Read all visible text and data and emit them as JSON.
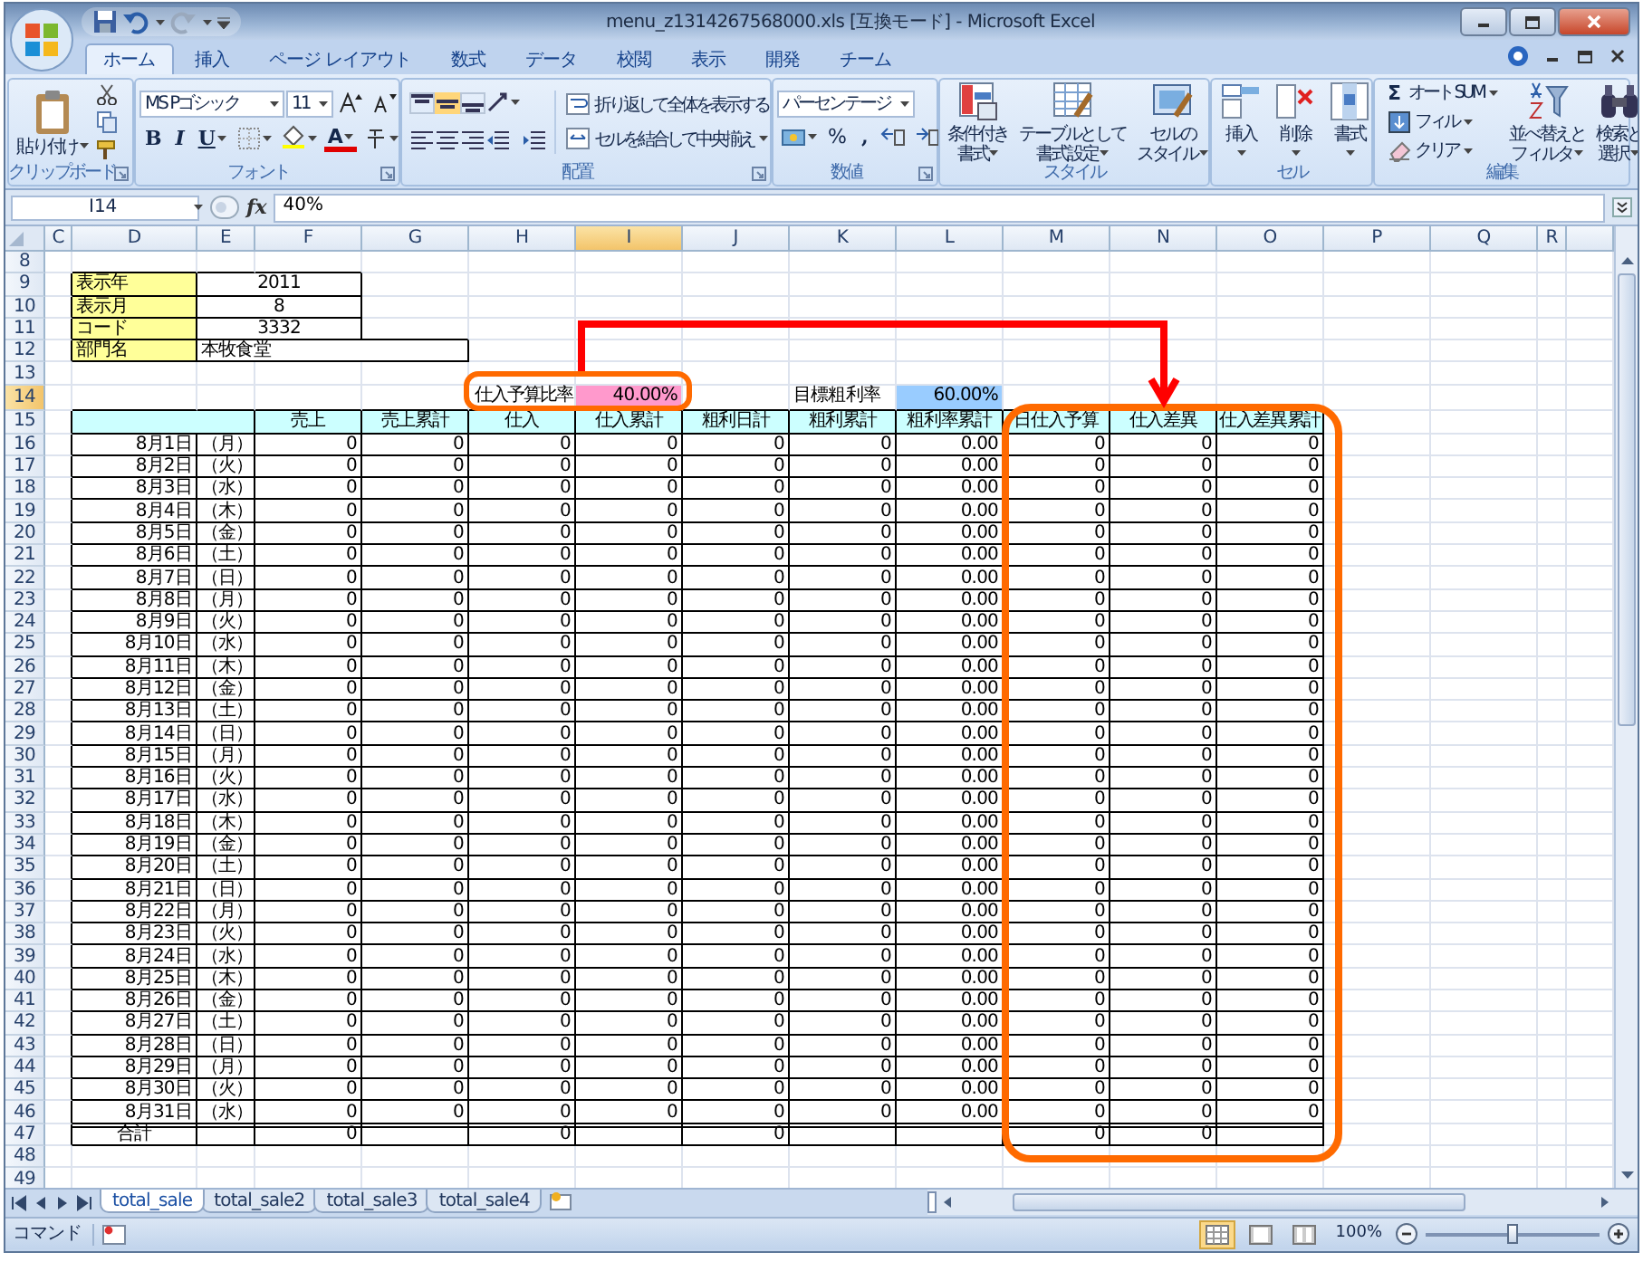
{
  "window": {
    "title": "menu_z1314267568000.xls [互換モード] - Microsoft Excel"
  },
  "ribbon_tabs": [
    {
      "label": "ホーム",
      "selected": true
    },
    {
      "label": "挿入",
      "selected": false
    },
    {
      "label": "ページ レイアウト",
      "selected": false
    },
    {
      "label": "数式",
      "selected": false
    },
    {
      "label": "データ",
      "selected": false
    },
    {
      "label": "校閲",
      "selected": false
    },
    {
      "label": "表示",
      "selected": false
    },
    {
      "label": "開発",
      "selected": false
    },
    {
      "label": "チーム",
      "selected": false
    }
  ],
  "ribbon": {
    "clipboard": {
      "label": "クリップボード",
      "paste": "貼り付け"
    },
    "font": {
      "label": "フォント",
      "font_name": "MS Pゴシック",
      "font_size": "11",
      "bold": "B",
      "italic": "I",
      "underline": "U",
      "font_color": "A"
    },
    "alignment": {
      "label": "配置",
      "wrap_text": "折り返して全体を表示する",
      "merge_center": "セルを結合して中央揃え"
    },
    "number": {
      "label": "数値",
      "format": "パーセンテージ",
      "percent": "%",
      "comma": ","
    },
    "styles": {
      "label": "スタイル",
      "buttons": [
        {
          "lines": [
            "条件付き",
            "書式"
          ],
          "kind": "conditional"
        },
        {
          "lines": [
            "テーブルとして",
            "書式設定"
          ],
          "kind": "table"
        },
        {
          "lines": [
            "セルの",
            "スタイル"
          ],
          "kind": "cellstyle"
        }
      ]
    },
    "cells": {
      "label": "セル",
      "buttons": [
        {
          "label": "挿入",
          "kind": "insert"
        },
        {
          "label": "削除",
          "kind": "delete"
        },
        {
          "label": "書式",
          "kind": "format"
        }
      ]
    },
    "editing": {
      "label": "編集",
      "sum_symbol": "Σ",
      "autosum": "オート SUM",
      "fill": "フィル",
      "clear": "クリア",
      "buttons": [
        {
          "lines": [
            "並べ替えと",
            "フィルタ"
          ],
          "kind": "sort"
        },
        {
          "lines": [
            "検索と",
            "選択"
          ],
          "kind": "find"
        }
      ]
    }
  },
  "formula_bar": {
    "name_box": "I14",
    "function_label": "fx",
    "value": "40%"
  },
  "sheet": {
    "columns": [
      {
        "label": "C",
        "selected": false
      },
      {
        "label": "D",
        "selected": false
      },
      {
        "label": "E",
        "selected": false
      },
      {
        "label": "F",
        "selected": false
      },
      {
        "label": "G",
        "selected": false
      },
      {
        "label": "H",
        "selected": false
      },
      {
        "label": "I",
        "selected": true
      },
      {
        "label": "J",
        "selected": false
      },
      {
        "label": "K",
        "selected": false
      },
      {
        "label": "L",
        "selected": false
      },
      {
        "label": "M",
        "selected": false
      },
      {
        "label": "N",
        "selected": false
      },
      {
        "label": "O",
        "selected": false
      },
      {
        "label": "P",
        "selected": false
      },
      {
        "label": "Q",
        "selected": false
      },
      {
        "label": "R",
        "selected": false
      }
    ],
    "rows": [
      {
        "number": "8",
        "selected": false,
        "kind": "blank"
      },
      {
        "number": "9",
        "selected": false,
        "kind": "info",
        "cells": [
          {
            "kind": "empty"
          },
          {
            "kind": "label",
            "text": "表示年"
          },
          {
            "kind": "value",
            "text": "2011"
          },
          {
            "kind": "merged"
          }
        ]
      },
      {
        "number": "10",
        "selected": false,
        "kind": "info",
        "cells": [
          {
            "kind": "empty"
          },
          {
            "kind": "label",
            "text": "表示月"
          },
          {
            "kind": "value",
            "text": "8"
          },
          {
            "kind": "merged"
          }
        ]
      },
      {
        "number": "11",
        "selected": false,
        "kind": "info",
        "cells": [
          {
            "kind": "empty"
          },
          {
            "kind": "label",
            "text": "コード"
          },
          {
            "kind": "value",
            "text": "3332"
          },
          {
            "kind": "merged"
          }
        ]
      },
      {
        "number": "12",
        "selected": false,
        "kind": "info",
        "cells": [
          {
            "kind": "empty"
          },
          {
            "kind": "label",
            "text": "部門名"
          },
          {
            "kind": "value_left",
            "text": "本牧食堂"
          },
          {
            "kind": "merged"
          },
          {
            "kind": "merged"
          }
        ]
      },
      {
        "number": "13",
        "selected": false,
        "kind": "blank"
      },
      {
        "number": "14",
        "selected": true,
        "kind": "info",
        "cells": [
          {
            "kind": "empty"
          },
          {
            "kind": "empty"
          },
          {
            "kind": "empty"
          },
          {
            "kind": "empty"
          },
          {
            "kind": "empty"
          },
          {
            "kind": "caption_right",
            "text": "仕入予算比率"
          },
          {
            "kind": "pink",
            "text": "40.00%"
          },
          {
            "kind": "empty"
          },
          {
            "kind": "caption",
            "text": "目標粗利率"
          },
          {
            "kind": "blue",
            "text": "60.00%"
          }
        ]
      },
      {
        "number": "15",
        "selected": false,
        "kind": "header",
        "cells": [
          {
            "kind": "empty"
          },
          {
            "kind": "header"
          },
          {
            "kind": "merged"
          },
          {
            "kind": "header",
            "text": "売上"
          },
          {
            "kind": "header",
            "text": "売上累計"
          },
          {
            "kind": "header",
            "text": "仕入"
          },
          {
            "kind": "header",
            "text": "仕入累計"
          },
          {
            "kind": "header",
            "text": "粗利日計"
          },
          {
            "kind": "header",
            "text": "粗利累計"
          },
          {
            "kind": "header",
            "text": "粗利率累計"
          },
          {
            "kind": "header",
            "text": "日仕入予算"
          },
          {
            "kind": "header",
            "text": "仕入差異"
          },
          {
            "kind": "header",
            "text": "仕入差異累計"
          }
        ]
      },
      {
        "number": "16",
        "selected": false,
        "kind": "data",
        "values": [
          "8月1日",
          "（月）",
          "0",
          "0",
          "0",
          "0",
          "0",
          "0",
          "0.00",
          "0",
          "0",
          "0"
        ]
      },
      {
        "number": "17",
        "selected": false,
        "kind": "data",
        "values": [
          "8月2日",
          "（火）",
          "0",
          "0",
          "0",
          "0",
          "0",
          "0",
          "0.00",
          "0",
          "0",
          "0"
        ]
      },
      {
        "number": "18",
        "selected": false,
        "kind": "data",
        "values": [
          "8月3日",
          "（水）",
          "0",
          "0",
          "0",
          "0",
          "0",
          "0",
          "0.00",
          "0",
          "0",
          "0"
        ]
      },
      {
        "number": "19",
        "selected": false,
        "kind": "data",
        "values": [
          "8月4日",
          "（木）",
          "0",
          "0",
          "0",
          "0",
          "0",
          "0",
          "0.00",
          "0",
          "0",
          "0"
        ]
      },
      {
        "number": "20",
        "selected": false,
        "kind": "data",
        "values": [
          "8月5日",
          "（金）",
          "0",
          "0",
          "0",
          "0",
          "0",
          "0",
          "0.00",
          "0",
          "0",
          "0"
        ]
      },
      {
        "number": "21",
        "selected": false,
        "kind": "data",
        "values": [
          "8月6日",
          "（土）",
          "0",
          "0",
          "0",
          "0",
          "0",
          "0",
          "0.00",
          "0",
          "0",
          "0"
        ]
      },
      {
        "number": "22",
        "selected": false,
        "kind": "data",
        "values": [
          "8月7日",
          "（日）",
          "0",
          "0",
          "0",
          "0",
          "0",
          "0",
          "0.00",
          "0",
          "0",
          "0"
        ]
      },
      {
        "number": "23",
        "selected": false,
        "kind": "data",
        "values": [
          "8月8日",
          "（月）",
          "0",
          "0",
          "0",
          "0",
          "0",
          "0",
          "0.00",
          "0",
          "0",
          "0"
        ]
      },
      {
        "number": "24",
        "selected": false,
        "kind": "data",
        "values": [
          "8月9日",
          "（火）",
          "0",
          "0",
          "0",
          "0",
          "0",
          "0",
          "0.00",
          "0",
          "0",
          "0"
        ]
      },
      {
        "number": "25",
        "selected": false,
        "kind": "data",
        "values": [
          "8月10日",
          "（水）",
          "0",
          "0",
          "0",
          "0",
          "0",
          "0",
          "0.00",
          "0",
          "0",
          "0"
        ]
      },
      {
        "number": "26",
        "selected": false,
        "kind": "data",
        "values": [
          "8月11日",
          "（木）",
          "0",
          "0",
          "0",
          "0",
          "0",
          "0",
          "0.00",
          "0",
          "0",
          "0"
        ]
      },
      {
        "number": "27",
        "selected": false,
        "kind": "data",
        "values": [
          "8月12日",
          "（金）",
          "0",
          "0",
          "0",
          "0",
          "0",
          "0",
          "0.00",
          "0",
          "0",
          "0"
        ]
      },
      {
        "number": "28",
        "selected": false,
        "kind": "data",
        "values": [
          "8月13日",
          "（土）",
          "0",
          "0",
          "0",
          "0",
          "0",
          "0",
          "0.00",
          "0",
          "0",
          "0"
        ]
      },
      {
        "number": "29",
        "selected": false,
        "kind": "data",
        "values": [
          "8月14日",
          "（日）",
          "0",
          "0",
          "0",
          "0",
          "0",
          "0",
          "0.00",
          "0",
          "0",
          "0"
        ]
      },
      {
        "number": "30",
        "selected": false,
        "kind": "data",
        "values": [
          "8月15日",
          "（月）",
          "0",
          "0",
          "0",
          "0",
          "0",
          "0",
          "0.00",
          "0",
          "0",
          "0"
        ]
      },
      {
        "number": "31",
        "selected": false,
        "kind": "data",
        "values": [
          "8月16日",
          "（火）",
          "0",
          "0",
          "0",
          "0",
          "0",
          "0",
          "0.00",
          "0",
          "0",
          "0"
        ]
      },
      {
        "number": "32",
        "selected": false,
        "kind": "data",
        "values": [
          "8月17日",
          "（水）",
          "0",
          "0",
          "0",
          "0",
          "0",
          "0",
          "0.00",
          "0",
          "0",
          "0"
        ]
      },
      {
        "number": "33",
        "selected": false,
        "kind": "data",
        "values": [
          "8月18日",
          "（木）",
          "0",
          "0",
          "0",
          "0",
          "0",
          "0",
          "0.00",
          "0",
          "0",
          "0"
        ]
      },
      {
        "number": "34",
        "selected": false,
        "kind": "data",
        "values": [
          "8月19日",
          "（金）",
          "0",
          "0",
          "0",
          "0",
          "0",
          "0",
          "0.00",
          "0",
          "0",
          "0"
        ]
      },
      {
        "number": "35",
        "selected": false,
        "kind": "data",
        "values": [
          "8月20日",
          "（土）",
          "0",
          "0",
          "0",
          "0",
          "0",
          "0",
          "0.00",
          "0",
          "0",
          "0"
        ]
      },
      {
        "number": "36",
        "selected": false,
        "kind": "data",
        "values": [
          "8月21日",
          "（日）",
          "0",
          "0",
          "0",
          "0",
          "0",
          "0",
          "0.00",
          "0",
          "0",
          "0"
        ]
      },
      {
        "number": "37",
        "selected": false,
        "kind": "data",
        "values": [
          "8月22日",
          "（月）",
          "0",
          "0",
          "0",
          "0",
          "0",
          "0",
          "0.00",
          "0",
          "0",
          "0"
        ]
      },
      {
        "number": "38",
        "selected": false,
        "kind": "data",
        "values": [
          "8月23日",
          "（火）",
          "0",
          "0",
          "0",
          "0",
          "0",
          "0",
          "0.00",
          "0",
          "0",
          "0"
        ]
      },
      {
        "number": "39",
        "selected": false,
        "kind": "data",
        "values": [
          "8月24日",
          "（水）",
          "0",
          "0",
          "0",
          "0",
          "0",
          "0",
          "0.00",
          "0",
          "0",
          "0"
        ]
      },
      {
        "number": "40",
        "selected": false,
        "kind": "data",
        "values": [
          "8月25日",
          "（木）",
          "0",
          "0",
          "0",
          "0",
          "0",
          "0",
          "0.00",
          "0",
          "0",
          "0"
        ]
      },
      {
        "number": "41",
        "selected": false,
        "kind": "data",
        "values": [
          "8月26日",
          "（金）",
          "0",
          "0",
          "0",
          "0",
          "0",
          "0",
          "0.00",
          "0",
          "0",
          "0"
        ]
      },
      {
        "number": "42",
        "selected": false,
        "kind": "data",
        "values": [
          "8月27日",
          "（土）",
          "0",
          "0",
          "0",
          "0",
          "0",
          "0",
          "0.00",
          "0",
          "0",
          "0"
        ]
      },
      {
        "number": "43",
        "selected": false,
        "kind": "data",
        "values": [
          "8月28日",
          "（日）",
          "0",
          "0",
          "0",
          "0",
          "0",
          "0",
          "0.00",
          "0",
          "0",
          "0"
        ]
      },
      {
        "number": "44",
        "selected": false,
        "kind": "data",
        "values": [
          "8月29日",
          "（月）",
          "0",
          "0",
          "0",
          "0",
          "0",
          "0",
          "0.00",
          "0",
          "0",
          "0"
        ]
      },
      {
        "number": "45",
        "selected": false,
        "kind": "data",
        "values": [
          "8月30日",
          "（火）",
          "0",
          "0",
          "0",
          "0",
          "0",
          "0",
          "0.00",
          "0",
          "0",
          "0"
        ]
      },
      {
        "number": "46",
        "selected": false,
        "kind": "data",
        "values": [
          "8月31日",
          "（水）",
          "0",
          "0",
          "0",
          "0",
          "0",
          "0",
          "0.00",
          "0",
          "0",
          "0"
        ]
      },
      {
        "number": "47",
        "selected": false,
        "kind": "total",
        "cells": [
          {
            "kind": "empty"
          },
          {
            "kind": "total_label",
            "text": "合計"
          },
          {
            "kind": "total"
          },
          {
            "kind": "total",
            "text": "0"
          },
          {
            "kind": "total"
          },
          {
            "kind": "total",
            "text": "0"
          },
          {
            "kind": "total"
          },
          {
            "kind": "total",
            "text": "0"
          },
          {
            "kind": "total"
          },
          {
            "kind": "total"
          },
          {
            "kind": "total",
            "text": "0"
          },
          {
            "kind": "total",
            "text": "0"
          },
          {
            "kind": "total"
          }
        ]
      },
      {
        "number": "48",
        "selected": false,
        "kind": "blank"
      },
      {
        "number": "49",
        "selected": false,
        "kind": "blank"
      }
    ]
  },
  "sheet_tabs": [
    {
      "label": "total_sale",
      "selected": true
    },
    {
      "label": "total_sale2",
      "selected": false
    },
    {
      "label": "total_sale3",
      "selected": false
    },
    {
      "label": "total_sale4",
      "selected": false
    }
  ],
  "status_bar": {
    "mode": "コマンド",
    "views": [
      {
        "kind": "normal",
        "selected": true
      },
      {
        "kind": "layout",
        "selected": false
      },
      {
        "kind": "pagebreak",
        "selected": false
      }
    ],
    "zoom": "100%",
    "zoom_slider": {
      "level": 0.5
    }
  }
}
